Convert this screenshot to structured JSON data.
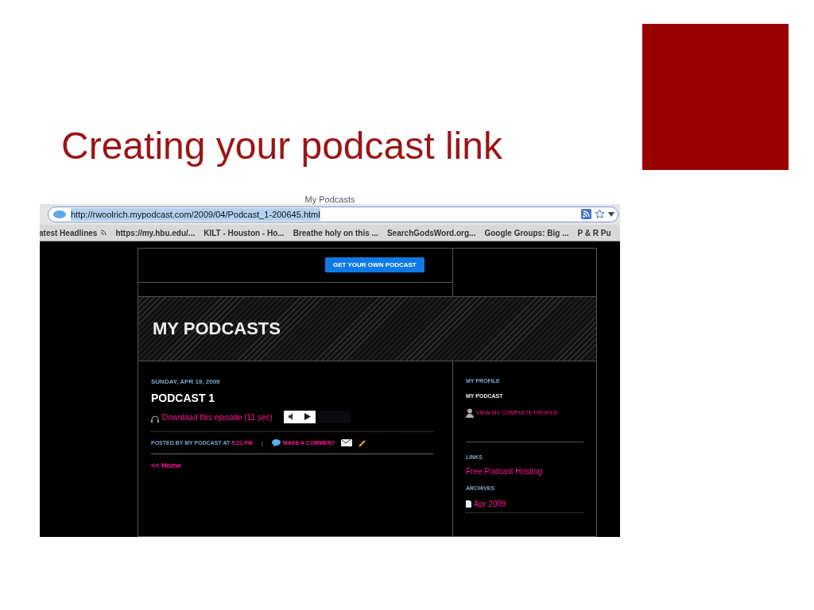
{
  "slide": {
    "title": "Creating your podcast link"
  },
  "browser": {
    "window_title": "My Podcasts",
    "url": "http://rwoolrich.mypodcast.com/2009/04/Podcast_1-200645.html",
    "bookmarks": [
      {
        "label": "atest Headlines",
        "kind": "feed"
      },
      {
        "label": "https://my.hbu.edu/...",
        "kind": "plain"
      },
      {
        "label": "KILT - Houston - Ho...",
        "kind": "plain"
      },
      {
        "label": "Breathe holy on this ...",
        "kind": "plain"
      },
      {
        "label": "SearchGodsWord.org...",
        "kind": "plain"
      },
      {
        "label": "Google Groups: Big ...",
        "kind": "plain"
      },
      {
        "label": "P & R Pu",
        "kind": "plain"
      }
    ]
  },
  "page": {
    "header_button": "GET YOUR OWN PODCAST",
    "banner_title": "MY PODCASTS",
    "post": {
      "date": "SUNDAY, APR 19, 2009",
      "title": "PODCAST 1",
      "download": "Download this episode (11 sec)",
      "posted_by": "POSTED BY MY PODCAST AT",
      "time": "5:21 PM",
      "separator": "|",
      "comment": "MAKE A COMMENT",
      "home": "<< Home"
    },
    "sidebar": {
      "profile_heading": "MY PROFILE",
      "profile_name": "MY PODCAST",
      "profile_link": "VIEW MY COMPLETE PROFILE",
      "links_heading": "LINKS",
      "links": [
        "Free Podcast Hosting"
      ],
      "archives_heading": "ARCHIVES",
      "archives": [
        "Apr 2009"
      ]
    }
  }
}
